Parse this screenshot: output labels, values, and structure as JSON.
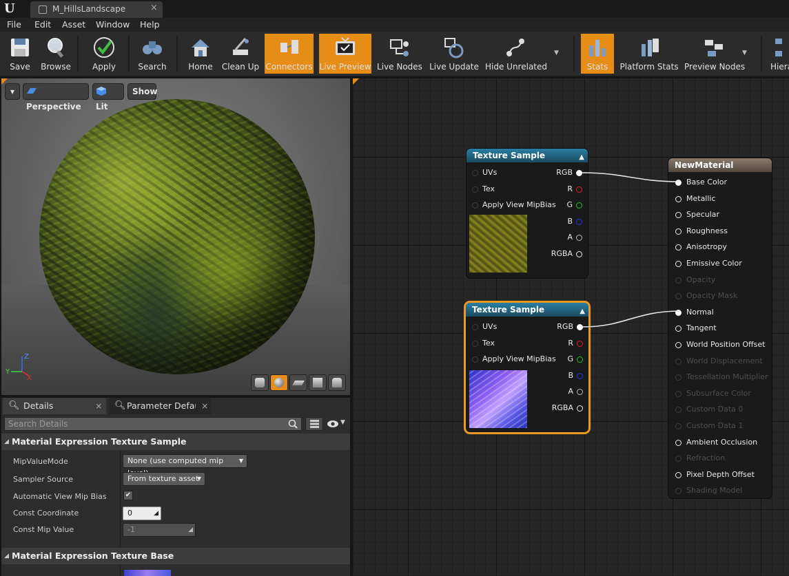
{
  "window": {
    "tab_title": "M_HillsLandscape",
    "tab_close": "×"
  },
  "menu": {
    "items": [
      "File",
      "Edit",
      "Asset",
      "Window",
      "Help"
    ]
  },
  "toolbar": {
    "buttons": [
      "Save",
      "Browse",
      "Apply",
      "Search",
      "Home",
      "Clean Up",
      "Connectors",
      "Live Preview",
      "Live Nodes",
      "Live Update",
      "Hide Unrelated",
      "Stats",
      "Platform Stats",
      "Preview Nodes",
      "Hiera"
    ],
    "active": [
      "Connectors",
      "Live Preview",
      "Stats"
    ],
    "accent_color": "#e58d16"
  },
  "viewport": {
    "menu_arrow": "▾",
    "perspective_label": "Perspective",
    "lit_label": "Lit",
    "show_label": "Show",
    "axis": {
      "x": "X",
      "y": "Y",
      "z": "Z"
    }
  },
  "details": {
    "tabs": [
      "Details",
      "Parameter Defaults"
    ],
    "tab_close": "×",
    "search_placeholder": "Search Details",
    "section1": "Material Expression Texture Sample",
    "props": [
      {
        "label": "MipValueMode",
        "value": "None (use computed mip level)"
      },
      {
        "label": "Sampler Source",
        "value": "From texture asset"
      },
      {
        "label": "Automatic View Mip Bias",
        "value": "✔"
      },
      {
        "label": "Const Coordinate",
        "value": "0"
      },
      {
        "label": "Const Mip Value",
        "value": "-1"
      }
    ],
    "section2": "Material Expression Texture Base",
    "collapse": "◢"
  },
  "graph": {
    "tex_nodes": [
      {
        "title": "Texture Sample",
        "inputs": [
          "UVs",
          "Tex",
          "Apply View MipBias"
        ],
        "outputs": [
          "RGB",
          "R",
          "G",
          "B",
          "A",
          "RGBA"
        ]
      },
      {
        "title": "Texture Sample",
        "inputs": [
          "UVs",
          "Tex",
          "Apply View MipBias"
        ],
        "outputs": [
          "RGB",
          "R",
          "G",
          "B",
          "A",
          "RGBA"
        ]
      }
    ],
    "collapse": "▲",
    "material_node": {
      "title": "NewMaterial",
      "pins": [
        "Base Color",
        "Metallic",
        "Specular",
        "Roughness",
        "Anisotropy",
        "Emissive Color",
        "Opacity",
        "Opacity Mask",
        "Normal",
        "Tangent",
        "World Position Offset",
        "World Displacement",
        "Tessellation Multiplier",
        "Subsurface Color",
        "Custom Data 0",
        "Custom Data 1",
        "Ambient Occlusion",
        "Refraction",
        "Pixel Depth Offset",
        "Shading Model"
      ],
      "disabled": [
        "Opacity",
        "Opacity Mask",
        "World Displacement",
        "Tessellation Multiplier",
        "Subsurface Color",
        "Custom Data 0",
        "Custom Data 1",
        "Refraction",
        "Shading Model"
      ]
    },
    "channel_colors": {
      "R": "#e02020",
      "G": "#20c020",
      "B": "#2030e0",
      "A": "#bbbbbb"
    }
  }
}
